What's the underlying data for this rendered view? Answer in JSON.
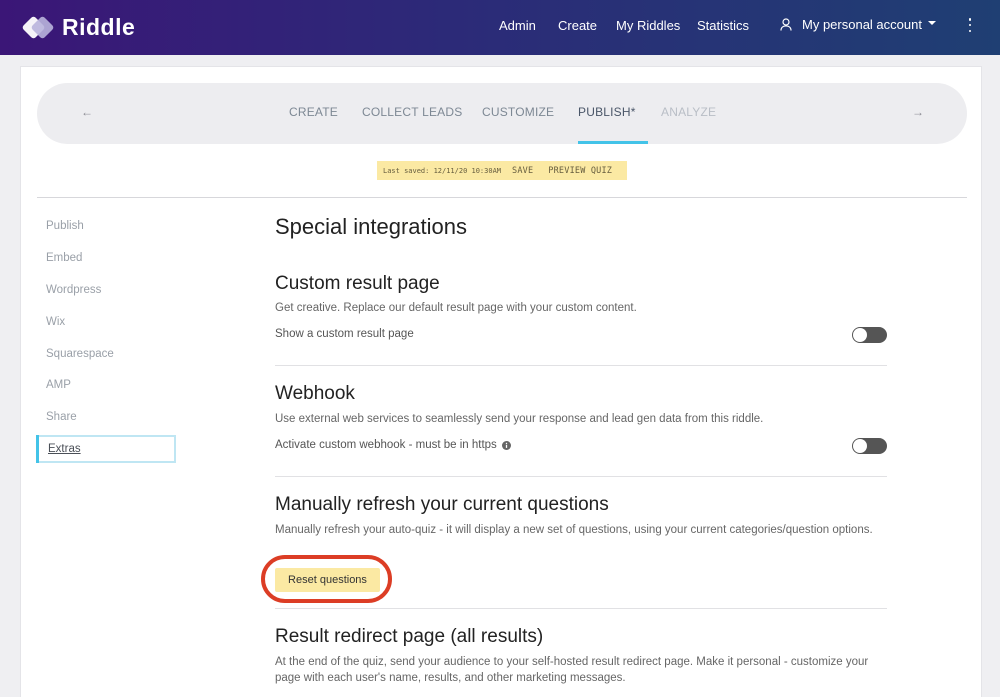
{
  "app": {
    "logo_text": "Riddle"
  },
  "nav": {
    "admin": "Admin",
    "create": "Create",
    "my_riddles": "My Riddles",
    "statistics": "Statistics",
    "account": "My personal account"
  },
  "steps": {
    "prev_arrow": "←",
    "next_arrow": "→",
    "items": [
      "CREATE",
      "COLLECT LEADS",
      "CUSTOMIZE",
      "PUBLISH*",
      "ANALYZE"
    ],
    "active": "PUBLISH*"
  },
  "save_bar": {
    "last_saved": "Last saved: 12/11/20 10:30AM",
    "save": "SAVE",
    "preview": "PREVIEW QUIZ"
  },
  "sidebar": {
    "items": [
      "Publish",
      "Embed",
      "Wordpress",
      "Wix",
      "Squarespace",
      "AMP",
      "Share",
      "Extras"
    ],
    "active": "Extras"
  },
  "content": {
    "title": "Special integrations",
    "custom_result": {
      "heading": "Custom result page",
      "desc": "Get creative. Replace our default result page with your custom content.",
      "toggle_label": "Show a custom result page",
      "toggle_on": false
    },
    "webhook": {
      "heading": "Webhook",
      "desc": "Use external web services to seamlessly send your response and lead gen data from this riddle.",
      "toggle_label": "Activate custom webhook - must be in https",
      "toggle_on": false
    },
    "refresh": {
      "heading": "Manually refresh your current questions",
      "desc": "Manually refresh your auto-quiz - it will display a new set of questions, using your current categories/question options.",
      "button": "Reset questions"
    },
    "redirect": {
      "heading": "Result redirect page (all results)",
      "desc": "At the end of the quiz, send your audience to your self-hosted result redirect page. Make it personal - customize your page with each user's name, results, and other marketing messages."
    }
  },
  "colors": {
    "accent": "#43c3e8",
    "highlight_ring": "#dc3d25",
    "button_yellow": "#fbe9a3",
    "nav_start": "#3b1677",
    "nav_end": "#1f3f73"
  }
}
